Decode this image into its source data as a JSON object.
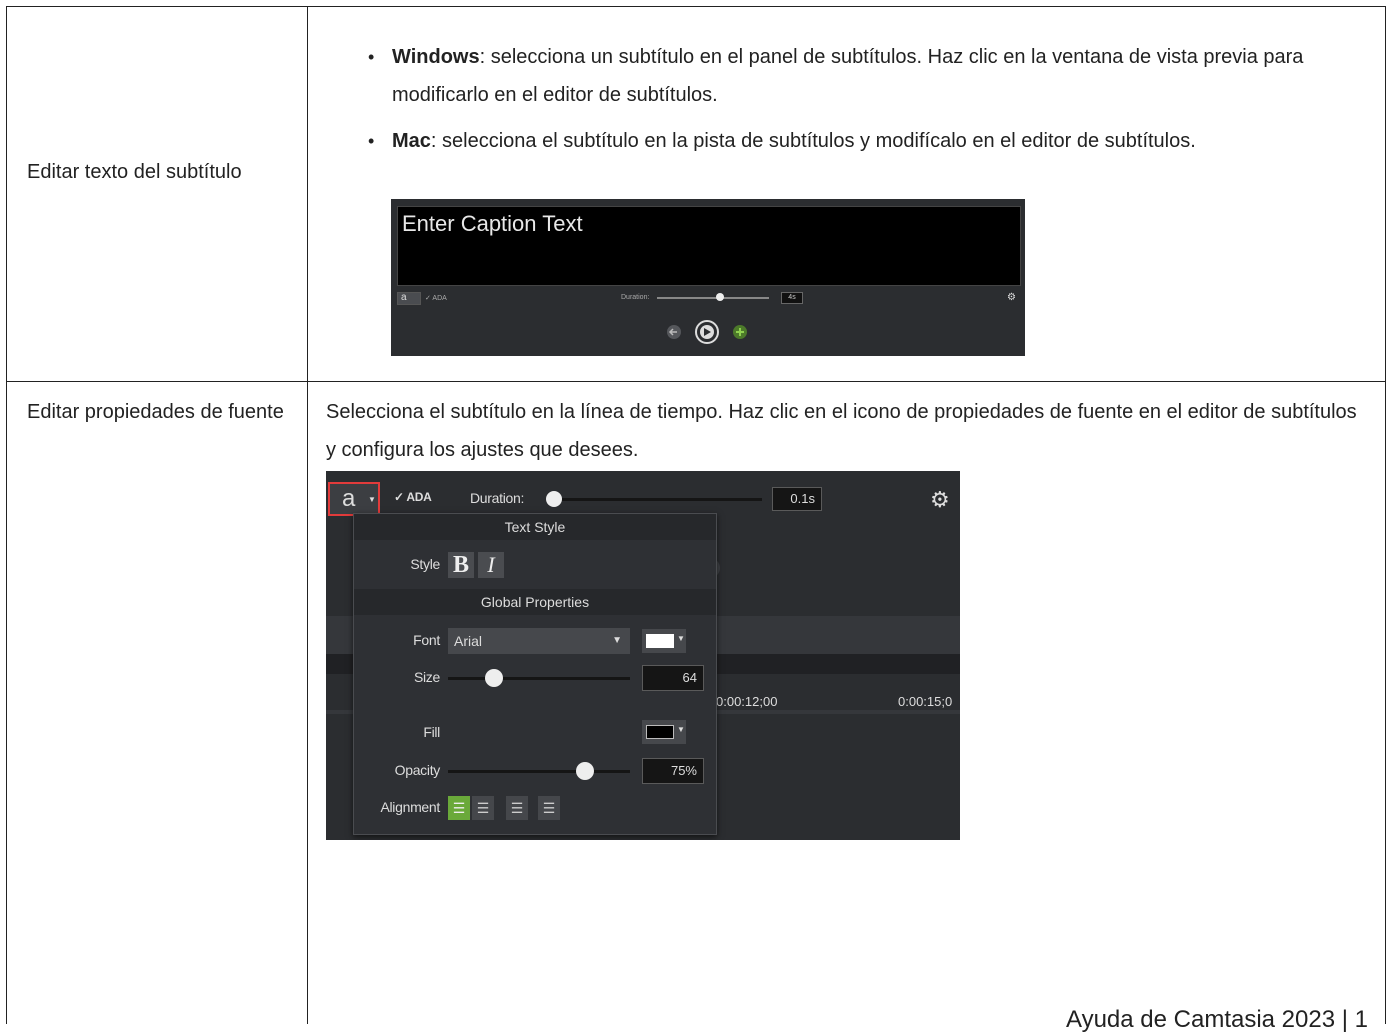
{
  "rows": [
    {
      "label": "Editar texto del subtítulo",
      "bullets": [
        {
          "bold": "Windows",
          "text": ": selecciona un subtítulo en el panel de subtítulos. Haz clic en la ventana de vista previa para modificarlo en el editor de subtítulos."
        },
        {
          "bold": "Mac",
          "text": ": selecciona el subtítulo en la pista de subtítulos y modifícalo en el editor de subtítulos."
        }
      ],
      "screenshot": {
        "caption_text": "Enter Caption Text",
        "font_button": "a",
        "ada": "✓ ADA",
        "duration_label": "Duration:",
        "duration_value": "4s"
      }
    },
    {
      "label": "Editar propiedades de fuente",
      "text": "Selecciona el subtítulo en la línea de tiempo. Haz clic en el icono de propiedades de fuente en el editor de subtítulos y configura los ajustes que desees.",
      "screenshot": {
        "font_button": "a",
        "ada": "✓ ADA",
        "duration_label": "Duration:",
        "duration_value": "0.1s",
        "text_style_header": "Text Style",
        "style_label": "Style",
        "bold_btn": "B",
        "italic_btn": "I",
        "global_header": "Global Properties",
        "font_label": "Font",
        "font_value": "Arial",
        "size_label": "Size",
        "size_value": "64",
        "size_level": 0.25,
        "fill_label": "Fill",
        "opacity_label": "Opacity",
        "opacity_value": "75%",
        "opacity_level": 0.75,
        "alignment_label": "Alignment",
        "ruler_1": "0:00:12;00",
        "ruler_2": "0:00:15;0",
        "font_color": "#ffffff",
        "fill_color": "#000000",
        "highlight_color": "#e23b3b",
        "accent_color": "#6aa93a"
      }
    }
  ],
  "footer": "Ayuda de Camtasia 2023 | 1"
}
